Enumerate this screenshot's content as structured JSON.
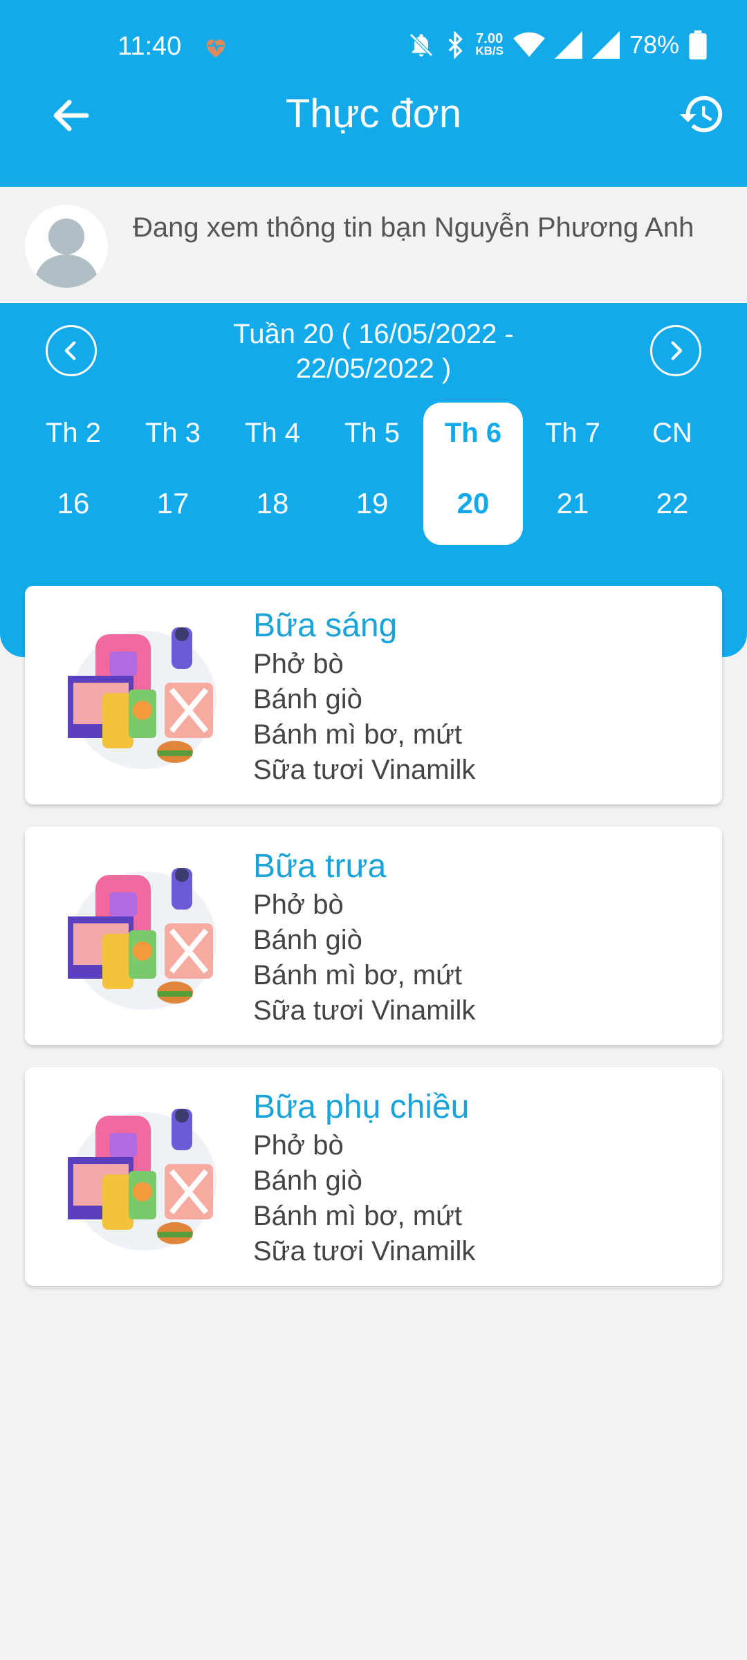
{
  "status_bar": {
    "time": "11:40",
    "net_speed_value": "7.00",
    "net_speed_unit": "KB/S",
    "battery": "78%"
  },
  "app_bar": {
    "title": "Thực đơn"
  },
  "student": {
    "text": "Đang xem thông tin bạn Nguyễn Phương Anh"
  },
  "week": {
    "label": "Tuần 20 ( 16/05/2022 - 22/05/2022 )",
    "days": [
      {
        "name": "Th 2",
        "date": "16"
      },
      {
        "name": "Th 3",
        "date": "17"
      },
      {
        "name": "Th 4",
        "date": "18"
      },
      {
        "name": "Th 5",
        "date": "19"
      },
      {
        "name": "Th 6",
        "date": "20"
      },
      {
        "name": "Th 7",
        "date": "21"
      },
      {
        "name": "CN",
        "date": "22"
      }
    ],
    "selected_index": 4
  },
  "meals": [
    {
      "title": "Bữa sáng",
      "items": [
        "Phở bò",
        "Bánh giò",
        "Bánh mì bơ, mứt",
        "Sữa tươi Vinamilk"
      ]
    },
    {
      "title": "Bữa trưa",
      "items": [
        "Phở bò",
        "Bánh giò",
        "Bánh mì bơ, mứt",
        "Sữa tươi Vinamilk"
      ]
    },
    {
      "title": "Bữa phụ chiều",
      "items": [
        "Phở bò",
        "Bánh giò",
        "Bánh mì bơ, mứt",
        "Sữa tươi Vinamilk"
      ]
    }
  ],
  "colors": {
    "primary": "#12aaea",
    "meal_title": "#1aa3d9",
    "background": "#f2f2f2"
  }
}
